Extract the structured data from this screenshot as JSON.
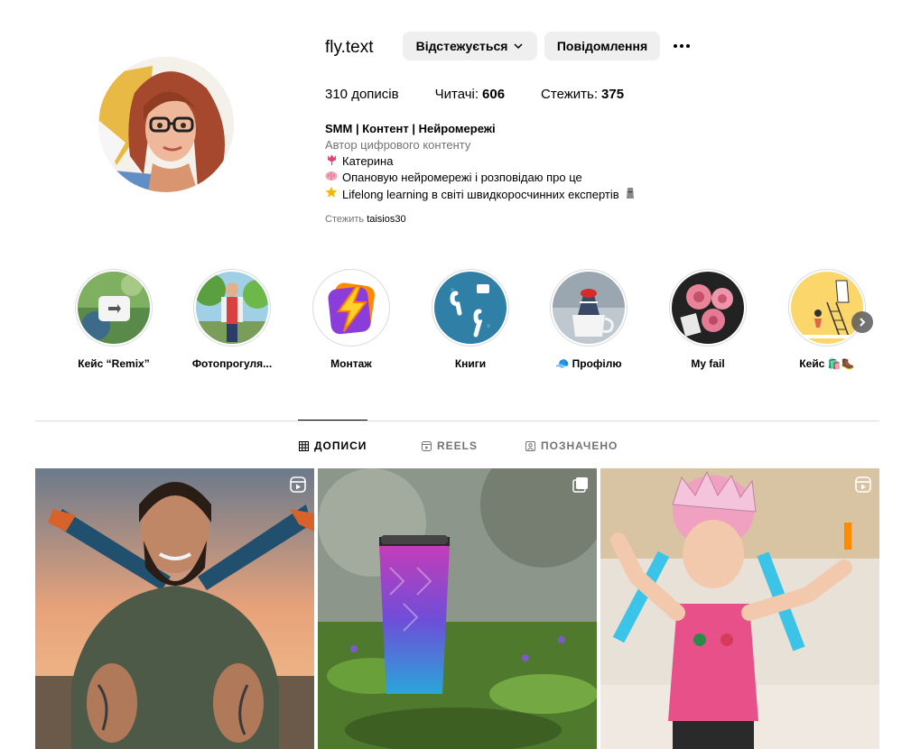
{
  "profile": {
    "username": "fly.text",
    "follow_label": "Відстежується",
    "message_label": "Повідомлення",
    "stats": {
      "posts_count": "310",
      "posts_label": "дописів",
      "followers_label": "Читачі:",
      "followers_count": "606",
      "following_label": "Стежить:",
      "following_count": "375"
    },
    "bio": {
      "name": "SMM | Контент | Нейромережі",
      "category": "Автор цифрового контенту",
      "lines": [
        {
          "icon": "tulip-icon",
          "text": "Катерина"
        },
        {
          "icon": "brain-icon",
          "text": "Опановую нейромережі і розповідаю про це"
        },
        {
          "icon": "star-icon",
          "text": "Lifelong learning в світі швидкоросчинних експертів"
        }
      ],
      "followed_by_label": "Стежить",
      "followed_by_user": "taisios30"
    }
  },
  "highlights": [
    {
      "label": "Кейс “Remix”",
      "icon": "remix-highlight"
    },
    {
      "label": "Фотопрогуля...",
      "icon": "photo-walk-highlight"
    },
    {
      "label": "Монтаж",
      "icon": "lightning-icon"
    },
    {
      "label": "Книги",
      "icon": "airpods-highlight"
    },
    {
      "label": "🧢 Профілю",
      "icon": "cup-highlight"
    },
    {
      "label": "My fail",
      "icon": "roses-highlight"
    },
    {
      "label": "Кейс 🛍️🥾",
      "icon": "ladder-highlight"
    }
  ],
  "tabs": [
    {
      "label": "ДОПИСИ",
      "active": true,
      "icon": "grid-icon"
    },
    {
      "label": "REELS",
      "active": false,
      "icon": "reels-icon"
    },
    {
      "label": "ПОЗНАЧЕНО",
      "active": false,
      "icon": "tagged-icon"
    }
  ],
  "posts": [
    {
      "type": "reel",
      "icon": "reels-icon",
      "subject": "bearded-man"
    },
    {
      "type": "carousel",
      "icon": "carousel-icon",
      "subject": "tumbler"
    },
    {
      "type": "reel",
      "icon": "reels-icon",
      "subject": "girl-helmet"
    }
  ],
  "colors": {
    "button_bg": "#efefef",
    "secondary_text": "#737373",
    "divider": "#dbdbdb"
  }
}
